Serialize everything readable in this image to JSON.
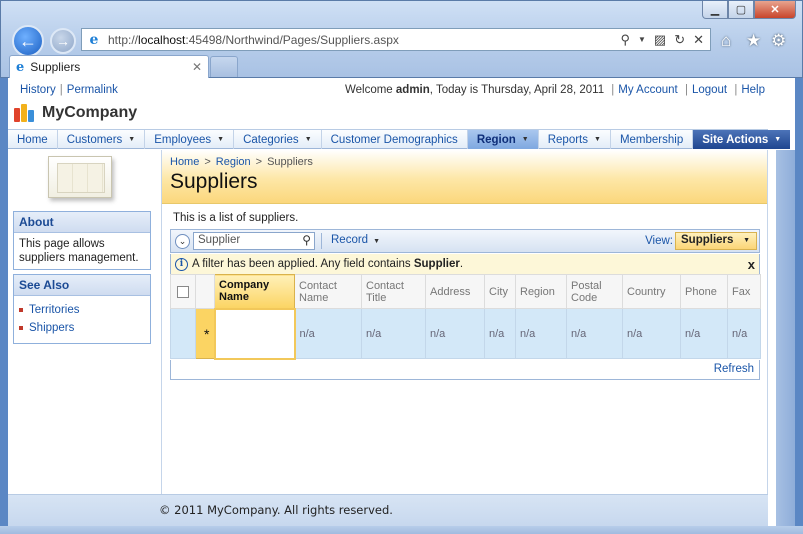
{
  "browser": {
    "url_prefix": "http://",
    "url_host": "localhost",
    "url_rest": ":45498/Northwind/Pages/Suppliers.aspx",
    "tab_title": "Suppliers"
  },
  "topbar": {
    "history": "History",
    "permalink": "Permalink",
    "welcome": "Welcome",
    "user": "admin",
    "date_text": ", Today is Thursday, April 28, 2011",
    "my_account": "My Account",
    "logout": "Logout",
    "help": "Help"
  },
  "brand": {
    "name": "MyCompany"
  },
  "menu": [
    {
      "label": "Home",
      "dropdown": false
    },
    {
      "label": "Customers",
      "dropdown": true
    },
    {
      "label": "Employees",
      "dropdown": true
    },
    {
      "label": "Categories",
      "dropdown": true
    },
    {
      "label": "Customer Demographics",
      "dropdown": false
    },
    {
      "label": "Region",
      "dropdown": true,
      "active": true
    },
    {
      "label": "Reports",
      "dropdown": true
    },
    {
      "label": "Membership",
      "dropdown": false
    },
    {
      "label": "Site Actions",
      "dropdown": true
    }
  ],
  "sidebar": {
    "about_title": "About",
    "about_text": "This page allows suppliers management.",
    "see_also_title": "See Also",
    "links": [
      "Territories",
      "Shippers"
    ]
  },
  "main": {
    "breadcrumb": [
      "Home",
      "Region",
      "Suppliers"
    ],
    "title": "Suppliers",
    "description": "This is a list of suppliers."
  },
  "toolbar": {
    "search_placeholder": "Supplier",
    "record_label": "Record",
    "view_label": "View:",
    "view_value": "Suppliers"
  },
  "filter": {
    "message_prefix": "A filter has been applied. Any field contains",
    "message_field": "Supplier",
    "message_suffix": ".",
    "close": "x"
  },
  "grid": {
    "columns": [
      "Company Name",
      "Contact Name",
      "Contact Title",
      "Address",
      "City",
      "Region",
      "Postal Code",
      "Country",
      "Phone",
      "Fax"
    ],
    "new_row_marker": "*",
    "empty_cell": "n/a",
    "refresh": "Refresh"
  },
  "footer": {
    "text": "© 2011 MyCompany. All rights reserved."
  },
  "colors": {
    "accent": "#1a55a8",
    "highlight": "#fbd463",
    "menu_active": "#7fa8e0",
    "site_actions": "#1f4690"
  }
}
